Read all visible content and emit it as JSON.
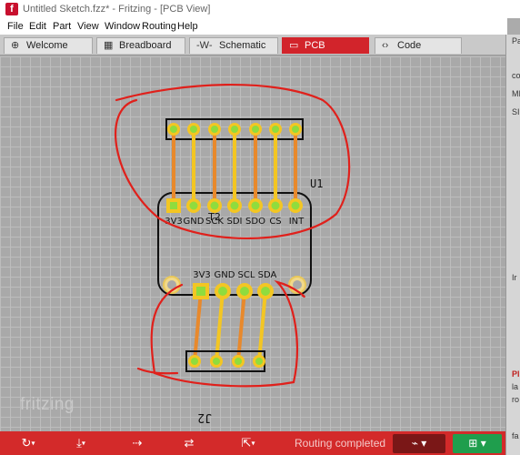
{
  "window": {
    "title": "Untitled Sketch.fzz* - Fritzing - [PCB View]",
    "app_icon_letter": "f"
  },
  "menu": [
    "File",
    "Edit",
    "Part",
    "View",
    "Window",
    "Routing",
    "Help"
  ],
  "tabs": [
    {
      "label": "Welcome",
      "icon": "globe-icon",
      "glyph": "⊕",
      "active": false
    },
    {
      "label": "Breadboard",
      "icon": "breadboard-icon",
      "glyph": "▦",
      "active": false
    },
    {
      "label": "Schematic",
      "icon": "schematic-icon",
      "glyph": "-W-",
      "active": false
    },
    {
      "label": "PCB",
      "icon": "pcb-icon",
      "glyph": "▭",
      "active": true
    },
    {
      "label": "Code",
      "icon": "code-icon",
      "glyph": "‹›",
      "active": false
    }
  ],
  "canvas": {
    "watermark": "fritzing",
    "u1": {
      "label": "U1",
      "pins": [
        "3V3",
        "GND",
        "SCK",
        "SDI",
        "SDO",
        "CS",
        "INT"
      ],
      "overlap_label": "T2"
    },
    "j2": {
      "pins": [
        "3V3",
        "GND",
        "SCL",
        "SDA"
      ],
      "label_mirrored": "J2"
    },
    "colors": {
      "trace_orange": "#e8892c",
      "trace_yellow": "#f3c623",
      "pad_green": "#8fdc3e",
      "board_gray": "#a9a9a9",
      "annotation_red": "#e0201b"
    }
  },
  "right_panel": {
    "texts": [
      "Pa",
      "co",
      "MI",
      "SI",
      "Ir",
      "Pl",
      "la",
      "ro",
      "fa"
    ]
  },
  "bottom_toolbar": {
    "tools": [
      {
        "name": "rotate-icon",
        "glyph": "↻"
      },
      {
        "name": "download-icon",
        "glyph": "⤓"
      },
      {
        "name": "vias-icon",
        "glyph": "⇢"
      },
      {
        "name": "autoroute-tool-icon",
        "glyph": "⇄"
      },
      {
        "name": "share-icon",
        "glyph": "⇱"
      }
    ],
    "status": "Routing completed",
    "route_button": "⌁",
    "export_button": "⊞"
  }
}
